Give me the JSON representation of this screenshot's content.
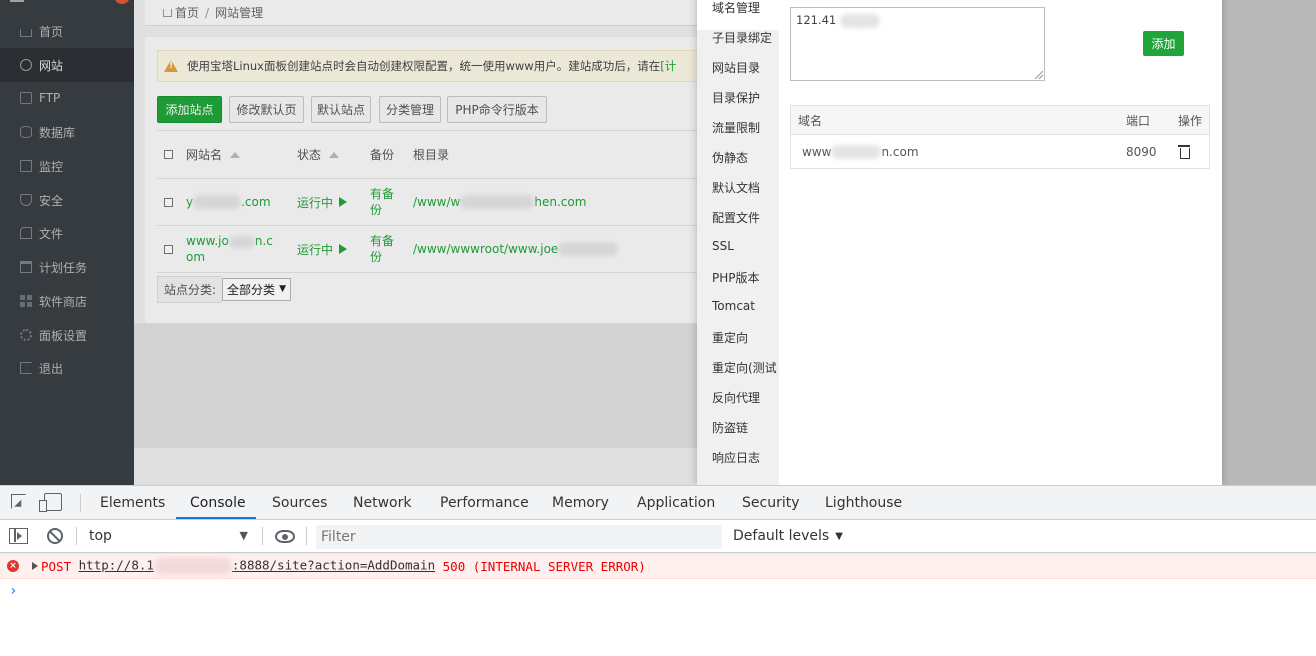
{
  "sidebar": {
    "items": [
      {
        "label": "首页",
        "icon": "home-icon"
      },
      {
        "label": "网站",
        "icon": "globe-icon",
        "active": true
      },
      {
        "label": "FTP",
        "icon": "ftp-icon"
      },
      {
        "label": "数据库",
        "icon": "database-icon"
      },
      {
        "label": "监控",
        "icon": "monitor-icon"
      },
      {
        "label": "安全",
        "icon": "shield-icon"
      },
      {
        "label": "文件",
        "icon": "folder-icon"
      },
      {
        "label": "计划任务",
        "icon": "calendar-icon"
      },
      {
        "label": "软件商店",
        "icon": "grid-icon"
      },
      {
        "label": "面板设置",
        "icon": "gear-icon"
      },
      {
        "label": "退出",
        "icon": "exit-icon"
      }
    ]
  },
  "breadcrumb": {
    "home": "首页",
    "sep": "/",
    "current": "网站管理"
  },
  "alert": {
    "text": "使用宝塔Linux面板创建站点时会自动创建权限配置，统一使用www用户。建站成功后，请在",
    "link": "[计"
  },
  "toolbar": {
    "add_site": "添加站点",
    "edit_default_page": "修改默认页",
    "default_site": "默认站点",
    "category_manage": "分类管理",
    "php_cli": "PHP命令行版本"
  },
  "site_table": {
    "headers": {
      "name": "网站名",
      "status": "状态",
      "backup": "备份",
      "root": "根目录"
    },
    "rows": [
      {
        "name_prefix": "y",
        "name_suffix": ".com",
        "status": "运行中",
        "backup": "有备份",
        "root_prefix": "/www/w",
        "root_suffix": "hen.com"
      },
      {
        "name_line1": "www.jo",
        "name_line1_suffix": "n.c",
        "name_line2": "om",
        "status": "运行中",
        "backup": "有备份",
        "root_prefix": "/www/wwwroot/www.joe"
      }
    ]
  },
  "category": {
    "label": "站点分类:",
    "selected": "全部分类"
  },
  "modal": {
    "nav": [
      "域名管理",
      "子目录绑定",
      "网站目录",
      "目录保护",
      "流量限制",
      "伪静态",
      "默认文档",
      "配置文件",
      "SSL",
      "PHP版本",
      "Tomcat",
      "重定向",
      "重定向(测试",
      "反向代理",
      "防盗链",
      "响应日志"
    ],
    "active_nav": "域名管理",
    "textarea_value": "121.41",
    "add_button": "添加",
    "domain_table": {
      "headers": {
        "domain": "域名",
        "port": "端口",
        "action": "操作"
      },
      "rows": [
        {
          "domain_prefix": "www",
          "domain_suffix": "n.com",
          "port": "8090"
        }
      ]
    }
  },
  "devtools": {
    "tabs": [
      "Elements",
      "Console",
      "Sources",
      "Network",
      "Performance",
      "Memory",
      "Application",
      "Security",
      "Lighthouse"
    ],
    "active_tab": "Console",
    "context": "top",
    "filter_placeholder": "Filter",
    "levels": "Default levels",
    "error": {
      "method": "POST",
      "url_prefix": "http://8.1",
      "url_suffix": ":8888/site?action=AddDomain",
      "status": "500 (INTERNAL SERVER ERROR)"
    },
    "prompt": "›"
  },
  "colors": {
    "accent_green": "#20a53a",
    "sidebar_bg": "#3a3f44",
    "devtools_blue": "#1a73e8",
    "error_red": "#e00000"
  }
}
